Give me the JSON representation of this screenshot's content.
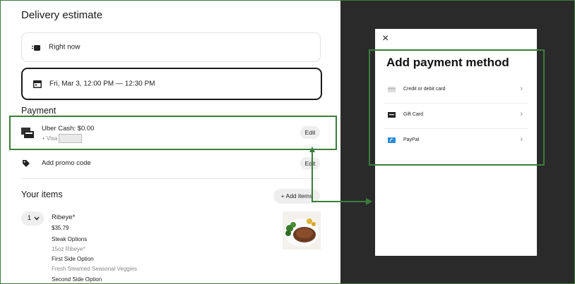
{
  "delivery": {
    "title": "Delivery estimate",
    "right_now": "Right now",
    "scheduled": "Fri, Mar 3, 12:00 PM — 12:30 PM"
  },
  "payment": {
    "title": "Payment",
    "uber_cash": "Uber Cash: $0.00",
    "visa_line": "+ Visa",
    "edit_label": "Edit",
    "promo_label": "Add promo code",
    "promo_edit": "Edit"
  },
  "items": {
    "title": "Your items",
    "add_button": "+ Add items",
    "list": [
      {
        "qty": "1",
        "name": "Ribeye*",
        "price": "$35.79",
        "opt1_label": "Steak Options",
        "opt1_value": "15oz Ribeye*",
        "opt2_label": "First Side Option",
        "opt2_value": "Fresh Steamed Seasonal Veggies",
        "opt3_label": "Second Side Option"
      }
    ]
  },
  "modal": {
    "close": "×",
    "title": "Add payment method",
    "options": [
      {
        "label": "Credit or debit card",
        "icon": "credit-card-icon"
      },
      {
        "label": "Gift Card",
        "icon": "gift-card-icon"
      },
      {
        "label": "PayPal",
        "icon": "paypal-icon"
      }
    ]
  },
  "colors": {
    "annotation_green": "#3a7d3a",
    "overlay_dark": "#2a2a2a"
  }
}
